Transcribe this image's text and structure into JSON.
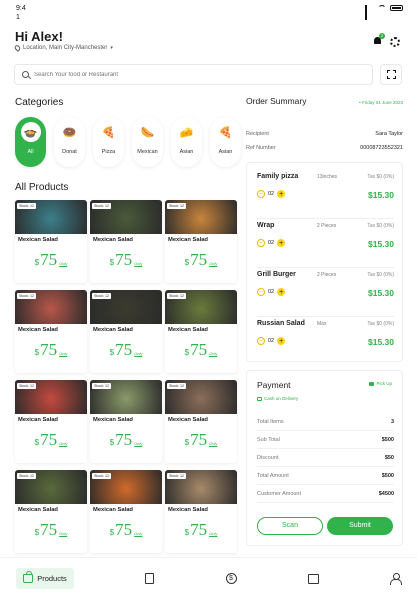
{
  "status": {
    "time": "9:4\n1"
  },
  "header": {
    "greeting": "Hi Alex!",
    "location": "Location, Main City-Manchester",
    "notification_count": "2"
  },
  "search": {
    "placeholder": "Search Your food or Restaurant"
  },
  "categories": {
    "title": "Categories",
    "items": [
      {
        "label": "All",
        "icon": "bowl-icon",
        "glyph": "🍲"
      },
      {
        "label": "Donat",
        "icon": "donut-icon",
        "glyph": "🍩"
      },
      {
        "label": "Pizza",
        "icon": "pizza-icon",
        "glyph": "🍕"
      },
      {
        "label": "Mexican",
        "icon": "hotdog-icon",
        "glyph": "🌭"
      },
      {
        "label": "Asian",
        "icon": "cheese-icon",
        "glyph": "🧀"
      },
      {
        "label": "Asian",
        "icon": "pizza-slice-icon",
        "glyph": "🍕"
      }
    ]
  },
  "products": {
    "title": "All Products",
    "items": [
      {
        "stock": "Stock: 12",
        "name": "Mexican Salad",
        "currency": "$",
        "price": "75",
        "note": "Only",
        "image": "#3d7f8a"
      },
      {
        "stock": "Stock: 12",
        "name": "Mexican Salad",
        "currency": "$",
        "price": "75",
        "note": "Only",
        "image": "#4a5a3a"
      },
      {
        "stock": "Stock: 12",
        "name": "Mexican Salad",
        "currency": "$",
        "price": "75",
        "note": "Only",
        "image": "#c9853d"
      },
      {
        "stock": "Stock: 12",
        "name": "Mexican Salad",
        "currency": "$",
        "price": "75",
        "note": "Only",
        "image": "#b8574a"
      },
      {
        "stock": "Stock: 12",
        "name": "Mexican Salad",
        "currency": "$",
        "price": "75",
        "note": "Only",
        "image": "#3b3b2f"
      },
      {
        "stock": "Stock: 12",
        "name": "Mexican Salad",
        "currency": "$",
        "price": "75",
        "note": "Only",
        "image": "#6a7b3c"
      },
      {
        "stock": "Stock: 12",
        "name": "Mexican Salad",
        "currency": "$",
        "price": "75",
        "note": "Only",
        "image": "#c34a3e"
      },
      {
        "stock": "Stock: 12",
        "name": "Mexican Salad",
        "currency": "$",
        "price": "75",
        "note": "Only",
        "image": "#8a9a6a"
      },
      {
        "stock": "Stock: 12",
        "name": "Mexican Salad",
        "currency": "$",
        "price": "75",
        "note": "Only",
        "image": "#8c6e5a"
      },
      {
        "stock": "Stock: 12",
        "name": "Mexican Salad",
        "currency": "$",
        "price": "75",
        "note": "Only",
        "image": "#5a6a3c"
      },
      {
        "stock": "Stock: 12",
        "name": "Mexican Salad",
        "currency": "$",
        "price": "75",
        "note": "Only",
        "image": "#d06a2a"
      },
      {
        "stock": "Stock: 12",
        "name": "Mexican Salad",
        "currency": "$",
        "price": "75",
        "note": "Only",
        "image": "#a88a6a"
      }
    ]
  },
  "order": {
    "title": "Order Summary",
    "date": "• Friday 01 June 2023",
    "recipient_label": "Recipient",
    "recipient": "Sara Taylor",
    "ref_label": "Ref Number",
    "ref": "00008723552321",
    "items": [
      {
        "name": "Family pizza",
        "size": "13inches",
        "tax": "Tax $0 (0%)",
        "qty": "02",
        "price": "$15.30"
      },
      {
        "name": "Wrap",
        "size": "2 Pieces",
        "tax": "Tax $0 (0%)",
        "qty": "02",
        "price": "$15.30"
      },
      {
        "name": "Grill Burger",
        "size": "2 Pieces",
        "tax": "Tax $0 (0%)",
        "qty": "02",
        "price": "$15.30"
      },
      {
        "name": "Russian Salad",
        "size": "Max",
        "tax": "Tax $0 (0%)",
        "qty": "02",
        "price": "$15.30"
      }
    ]
  },
  "payment": {
    "title": "Payment",
    "pickup": "Pick Up",
    "delivery": "Cash on Delivery",
    "rows": [
      {
        "label": "Total Items",
        "value": "3"
      },
      {
        "label": "Sub Total",
        "value": "$500"
      },
      {
        "label": "Discount",
        "value": "$50"
      },
      {
        "label": "Total Amount",
        "value": "$500"
      },
      {
        "label": "Customer Amount",
        "value": "$4500"
      }
    ],
    "scan_label": "Scan",
    "submit_label": "Submit"
  },
  "nav": {
    "products_label": "Products"
  },
  "colors": {
    "accent": "#2fb34a",
    "yellow": "#ffd21a"
  }
}
